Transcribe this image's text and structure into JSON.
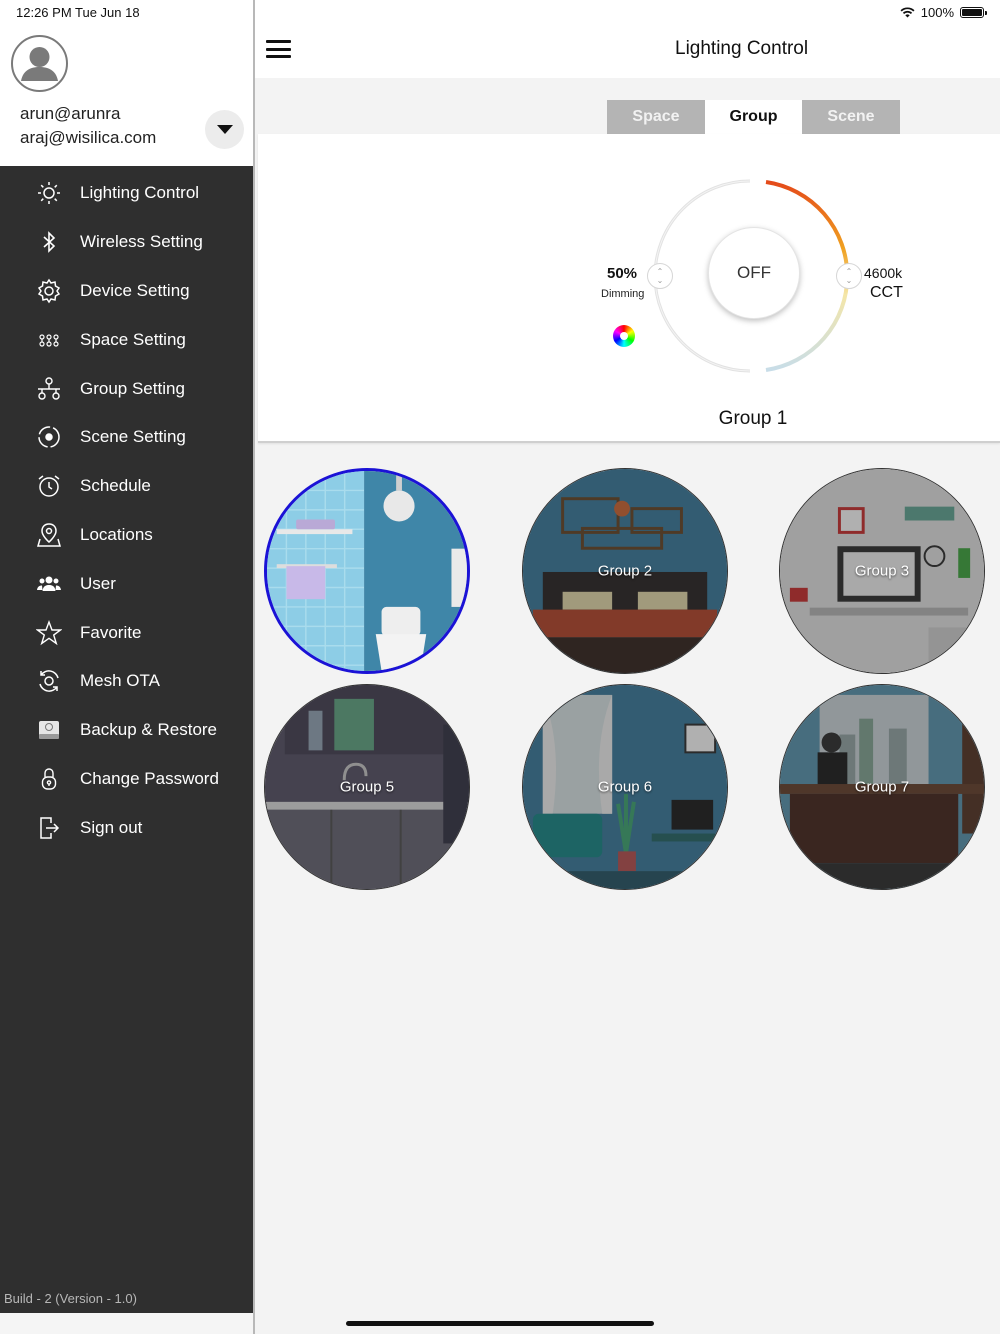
{
  "status_bar": {
    "time": "12:26 PM   Tue Jun 18",
    "battery": "100%"
  },
  "profile": {
    "username": "arun@arunra",
    "email": "araj@wisilica.com"
  },
  "menu": [
    {
      "label": "Lighting Control",
      "icon": "sun-icon"
    },
    {
      "label": "Wireless Setting",
      "icon": "bluetooth-icon"
    },
    {
      "label": "Device Setting",
      "icon": "gear-icon"
    },
    {
      "label": "Space Setting",
      "icon": "space-network-icon"
    },
    {
      "label": "Group Setting",
      "icon": "group-network-icon"
    },
    {
      "label": "Scene Setting",
      "icon": "scene-icon"
    },
    {
      "label": "Schedule",
      "icon": "alarm-clock-icon"
    },
    {
      "label": "Locations",
      "icon": "map-pin-icon"
    },
    {
      "label": "User",
      "icon": "users-icon"
    },
    {
      "label": "Favorite",
      "icon": "star-icon"
    },
    {
      "label": "Mesh OTA",
      "icon": "sync-icon"
    },
    {
      "label": "Backup & Restore",
      "icon": "backup-drive-icon"
    },
    {
      "label": "Change Password",
      "icon": "lock-icon"
    },
    {
      "label": "Sign out",
      "icon": "sign-out-icon"
    }
  ],
  "build": "Build - 2 (Version - 1.0)",
  "header": {
    "title": "Lighting Control"
  },
  "tabs": [
    {
      "label": "Space",
      "active": false
    },
    {
      "label": "Group",
      "active": true
    },
    {
      "label": "Scene",
      "active": false
    }
  ],
  "control": {
    "dimming_value": "50%",
    "dimming_label": "Dimming",
    "power_label": "OFF",
    "cct_value": "4600k",
    "cct_label": "CCT",
    "group_name": "Group 1"
  },
  "groups": [
    {
      "label": "",
      "scene": "bathroom",
      "selected": true
    },
    {
      "label": "Group 2",
      "scene": "bedroom",
      "selected": false
    },
    {
      "label": "Group 3",
      "scene": "office-desk",
      "selected": false
    },
    {
      "label": "Group 5",
      "scene": "kitchen",
      "selected": false
    },
    {
      "label": "Group 6",
      "scene": "living-room",
      "selected": false
    },
    {
      "label": "Group 7",
      "scene": "executive-office",
      "selected": false
    }
  ],
  "colors": {
    "sidebar_bg": "#2f2f2f",
    "selected_ring": "#1b12d6",
    "dial_warm": "#e8541c",
    "tab_inactive": "#b4b4b4"
  }
}
